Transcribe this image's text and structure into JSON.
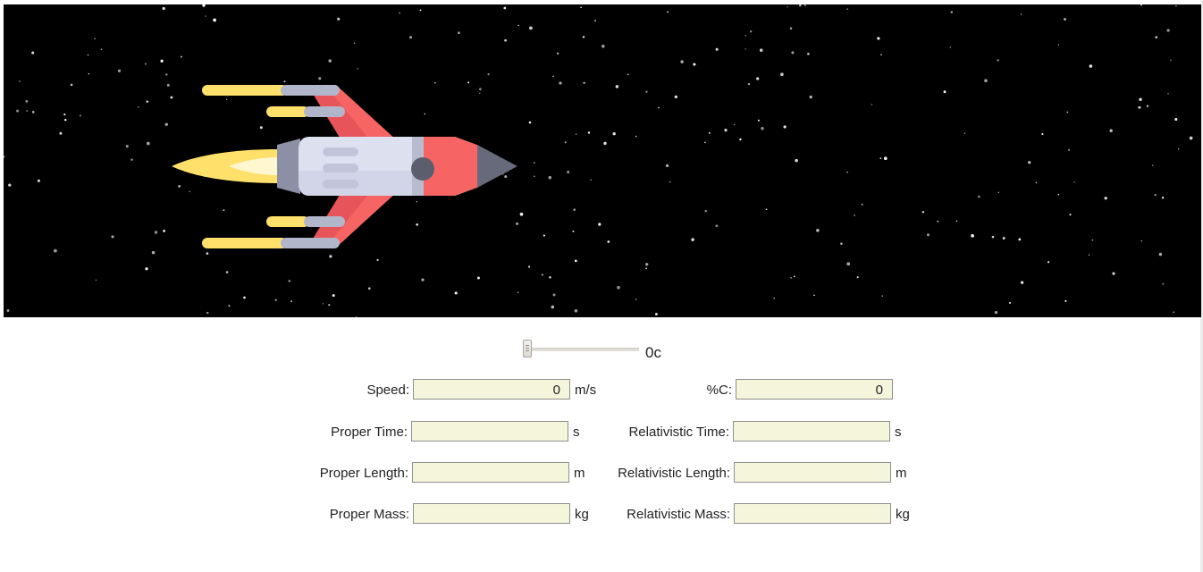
{
  "slider": {
    "value_fraction": 0,
    "readout": "0c"
  },
  "fields": {
    "speed": {
      "label": "Speed:",
      "value": "0",
      "unit": "m/s"
    },
    "percent_c": {
      "label": "%C:",
      "value": "0"
    },
    "proper_time": {
      "label": "Proper Time:",
      "value": "",
      "unit": "s"
    },
    "relativistic_time": {
      "label": "Relativistic Time:",
      "value": "",
      "unit": "s"
    },
    "proper_length": {
      "label": "Proper Length:",
      "value": "",
      "unit": "m"
    },
    "relativistic_length": {
      "label": "Relativistic Length:",
      "value": "",
      "unit": "m"
    },
    "proper_mass": {
      "label": "Proper Mass:",
      "value": "",
      "unit": "kg"
    },
    "relativistic_mass": {
      "label": "Relativistic Mass:",
      "value": "",
      "unit": "kg"
    }
  },
  "colors": {
    "space": "#000000",
    "field_background": "#f5f5dc",
    "rocket_body": "#dde0ef",
    "rocket_fins": "#f76464",
    "rocket_nose": "#676a7a",
    "flame": "#ffe06a"
  }
}
